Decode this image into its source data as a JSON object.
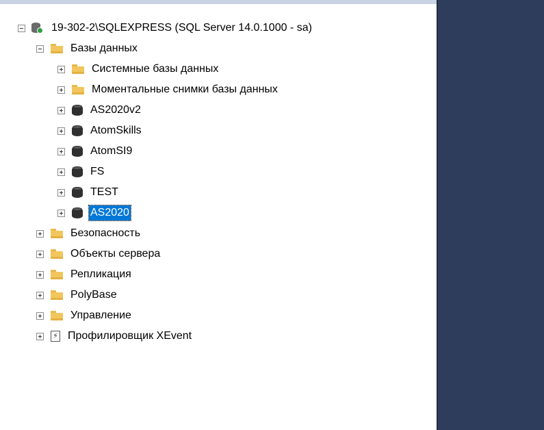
{
  "object_explorer": {
    "server": {
      "label": "19-302-2\\SQLEXPRESS (SQL Server 14.0.1000 - sa)",
      "expanded": true,
      "icon": "server-connected-icon"
    },
    "databases": {
      "label": "Базы данных",
      "expanded": true,
      "children": [
        {
          "label": "Системные базы данных",
          "icon": "folder-icon"
        },
        {
          "label": "Моментальные снимки базы данных",
          "icon": "folder-icon"
        },
        {
          "label": "AS2020v2",
          "icon": "database-icon"
        },
        {
          "label": "AtomSkills",
          "icon": "database-icon"
        },
        {
          "label": "AtomSI9",
          "icon": "database-icon"
        },
        {
          "label": "FS",
          "icon": "database-icon"
        },
        {
          "label": "TEST",
          "icon": "database-icon"
        },
        {
          "label": "AS2020",
          "icon": "database-icon",
          "selected": true
        }
      ]
    },
    "server_nodes": [
      {
        "label": "Безопасность",
        "icon": "folder-icon"
      },
      {
        "label": "Объекты сервера",
        "icon": "folder-icon"
      },
      {
        "label": "Репликация",
        "icon": "folder-icon"
      },
      {
        "label": "PolyBase",
        "icon": "folder-icon"
      },
      {
        "label": "Управление",
        "icon": "folder-icon"
      },
      {
        "label": "Профилировщик XEvent",
        "icon": "xevent-profiler-icon"
      }
    ],
    "colors": {
      "selection": "#0078d7",
      "right_panel": "#2d3d5b",
      "folder": "#f2c65c"
    }
  }
}
